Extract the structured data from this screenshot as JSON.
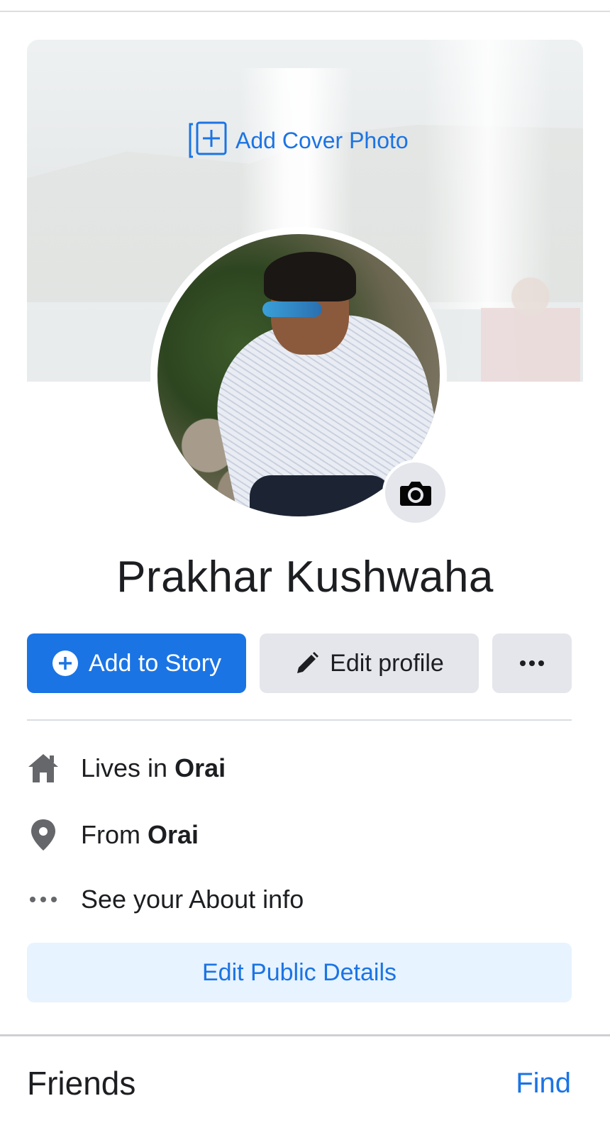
{
  "cover": {
    "add_label": "Add Cover Photo",
    "icon": "add-photo-icon"
  },
  "profile": {
    "name": "Prakhar Kushwaha",
    "camera_icon": "camera-icon"
  },
  "actions": {
    "add_story_label": "Add to Story",
    "edit_profile_label": "Edit profile",
    "more_icon": "more-horizontal-icon"
  },
  "details": {
    "lives_prefix": "Lives in",
    "lives_value": "Orai",
    "from_prefix": "From",
    "from_value": "Orai",
    "about_label": "See your About info",
    "edit_public_label": "Edit Public Details"
  },
  "friends": {
    "title": "Friends",
    "find_label": "Find"
  },
  "colors": {
    "accent": "#1b74e4",
    "button_gray": "#e4e6eb",
    "light_blue": "#e7f3ff",
    "text": "#1c1e21",
    "icon_gray": "#65676b"
  }
}
